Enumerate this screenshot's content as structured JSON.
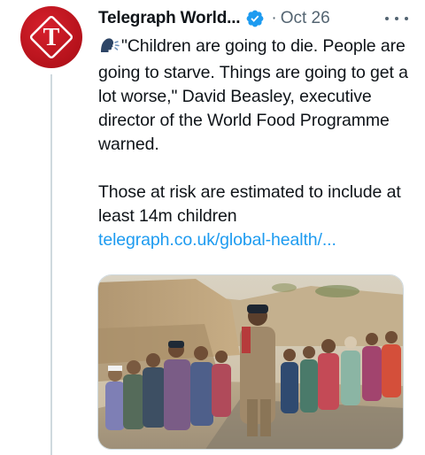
{
  "tweet": {
    "author_name": "Telegraph World...",
    "separator": "·",
    "date": "Oct 26",
    "avatar_letter": "T",
    "icons": {
      "verified": "verified-badge-icon",
      "more": "more-options-icon",
      "speaking": "speaking-head-emoji-icon"
    },
    "paragraph_1": "\"Children are going to die. People are going to starve. Things are going to get a lot worse,\" David Beasley, executive director of the World Food Programme warned.",
    "paragraph_2": "Those at risk are estimated to include at least 14m children",
    "link_text": "telegraph.co.uk/global-health/...",
    "colors": {
      "link": "#1d9bf0",
      "verified": "#1d9bf0",
      "avatar": "#c8151f",
      "muted": "#536471"
    }
  }
}
